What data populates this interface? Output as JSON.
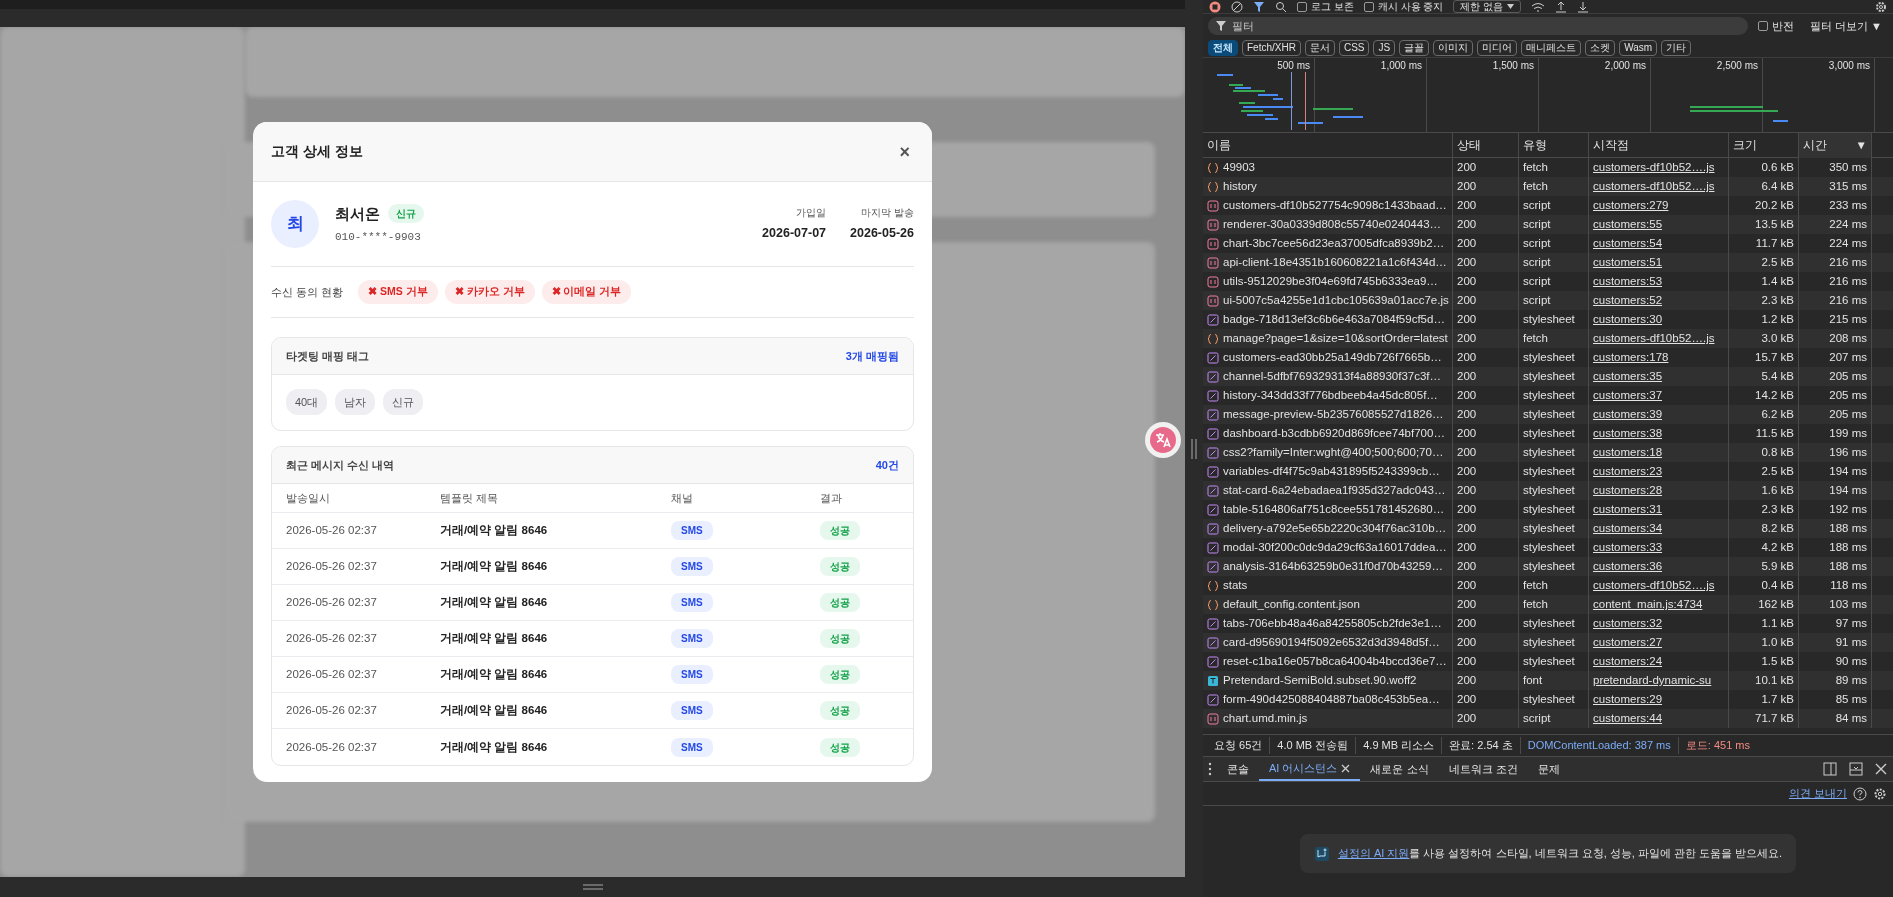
{
  "modal": {
    "title": "고객 상세 정보",
    "close": "×",
    "customer": {
      "initial": "최",
      "name": "최서온",
      "badge": "신규",
      "phone": "010-****-9903",
      "dates": [
        {
          "label": "가입일",
          "value": "2026-07-07"
        },
        {
          "label": "마지막 발송",
          "value": "2026-05-26"
        }
      ]
    },
    "consent": {
      "label": "수신 동의 현황",
      "items": [
        {
          "icon": "✖",
          "label": "SMS 거부",
          "agreed": false
        },
        {
          "icon": "✖",
          "label": "카카오 거부",
          "agreed": false
        },
        {
          "icon": "✖",
          "label": "이메일 거부",
          "agreed": false
        }
      ]
    },
    "tags": {
      "title": "타겟팅 매핑 태그",
      "count": "3개 매핑됨",
      "items": [
        "40대",
        "남자",
        "신규"
      ]
    },
    "messages": {
      "title": "최근 메시지 수신 내역",
      "count": "40건",
      "columns": [
        "발송일시",
        "템플릿 제목",
        "채널",
        "결과"
      ],
      "rows": [
        {
          "sent_at": "2026-05-26 02:37",
          "template": "거래/예약 알림 8646",
          "channel": "SMS",
          "result": "성공"
        },
        {
          "sent_at": "2026-05-26 02:37",
          "template": "거래/예약 알림 8646",
          "channel": "SMS",
          "result": "성공"
        },
        {
          "sent_at": "2026-05-26 02:37",
          "template": "거래/예약 알림 8646",
          "channel": "SMS",
          "result": "성공"
        },
        {
          "sent_at": "2026-05-26 02:37",
          "template": "거래/예약 알림 8646",
          "channel": "SMS",
          "result": "성공"
        },
        {
          "sent_at": "2026-05-26 02:37",
          "template": "거래/예약 알림 8646",
          "channel": "SMS",
          "result": "성공"
        },
        {
          "sent_at": "2026-05-26 02:37",
          "template": "거래/예약 알림 8646",
          "channel": "SMS",
          "result": "성공"
        },
        {
          "sent_at": "2026-05-26 02:37",
          "template": "거래/예약 알림 8646",
          "channel": "SMS",
          "result": "성공"
        }
      ]
    }
  },
  "devtools": {
    "toolbar": {
      "preserve_log": {
        "label": "로그 보존",
        "checked": false
      },
      "disable_cache": {
        "label": "캐시 사용 중지",
        "checked": false
      },
      "throttling": "제한 없음"
    },
    "filter": {
      "placeholder": "필터",
      "invert": {
        "label": "반전",
        "checked": false
      },
      "more": "필터 더보기 ▼"
    },
    "type_filters": [
      {
        "label": "전체",
        "selected": true
      },
      {
        "label": "Fetch/XHR",
        "selected": false
      },
      {
        "label": "문서",
        "selected": false
      },
      {
        "label": "CSS",
        "selected": false
      },
      {
        "label": "JS",
        "selected": false
      },
      {
        "label": "글꼴",
        "selected": false
      },
      {
        "label": "이미지",
        "selected": false
      },
      {
        "label": "미디어",
        "selected": false
      },
      {
        "label": "매니페스트",
        "selected": false
      },
      {
        "label": "소켓",
        "selected": false
      },
      {
        "label": "Wasm",
        "selected": false
      },
      {
        "label": "기타",
        "selected": false
      }
    ],
    "overview_ticks": [
      "500 ms",
      "1,000 ms",
      "1,500 ms",
      "2,000 ms",
      "2,500 ms",
      "3,000 ms"
    ],
    "columns": [
      {
        "label": "이름",
        "sorted": false
      },
      {
        "label": "상태",
        "sorted": false
      },
      {
        "label": "유형",
        "sorted": false
      },
      {
        "label": "시작점",
        "sorted": false
      },
      {
        "label": "크기",
        "sorted": false
      },
      {
        "label": "시간",
        "sorted": true,
        "sort_icon": "▼"
      }
    ],
    "requests": [
      {
        "kind": "fetch",
        "name": "49903",
        "status": "200",
        "type": "fetch",
        "initiator": "customers-df10b52….js",
        "size": "0.6 kB",
        "time": "350 ms"
      },
      {
        "kind": "fetch",
        "name": "history",
        "status": "200",
        "type": "fetch",
        "initiator": "customers-df10b52….js",
        "size": "6.4 kB",
        "time": "315 ms"
      },
      {
        "kind": "script",
        "name": "customers-df10b527754c9098c1433baad…",
        "status": "200",
        "type": "script",
        "initiator": "customers:279",
        "size": "20.2 kB",
        "time": "233 ms"
      },
      {
        "kind": "script",
        "name": "renderer-30a0339d808c55740e0240443…",
        "status": "200",
        "type": "script",
        "initiator": "customers:55",
        "size": "13.5 kB",
        "time": "224 ms"
      },
      {
        "kind": "script",
        "name": "chart-3bc7cee56d23ea37005dfca8939b2…",
        "status": "200",
        "type": "script",
        "initiator": "customers:54",
        "size": "11.7 kB",
        "time": "224 ms"
      },
      {
        "kind": "script",
        "name": "api-client-18e4351b160608221a1c6f434d…",
        "status": "200",
        "type": "script",
        "initiator": "customers:51",
        "size": "2.5 kB",
        "time": "216 ms"
      },
      {
        "kind": "script",
        "name": "utils-9512029be3f04e69fd745b6333ea9…",
        "status": "200",
        "type": "script",
        "initiator": "customers:53",
        "size": "1.4 kB",
        "time": "216 ms"
      },
      {
        "kind": "script",
        "name": "ui-5007c5a4255e1d1cbc105639a01acc7e.js",
        "status": "200",
        "type": "script",
        "initiator": "customers:52",
        "size": "2.3 kB",
        "time": "216 ms"
      },
      {
        "kind": "stylesheet",
        "name": "badge-718d13ef3c6b6e463a7084f59cf5d…",
        "status": "200",
        "type": "stylesheet",
        "initiator": "customers:30",
        "size": "1.2 kB",
        "time": "215 ms"
      },
      {
        "kind": "fetch",
        "name": "manage?page=1&size=10&sortOrder=latest",
        "status": "200",
        "type": "fetch",
        "initiator": "customers-df10b52….js",
        "size": "3.0 kB",
        "time": "208 ms"
      },
      {
        "kind": "stylesheet",
        "name": "customers-ead30bb25a149db726f7665b…",
        "status": "200",
        "type": "stylesheet",
        "initiator": "customers:178",
        "size": "15.7 kB",
        "time": "207 ms"
      },
      {
        "kind": "stylesheet",
        "name": "channel-5dfbf769329313f4a88930f37c3f…",
        "status": "200",
        "type": "stylesheet",
        "initiator": "customers:35",
        "size": "5.4 kB",
        "time": "205 ms"
      },
      {
        "kind": "stylesheet",
        "name": "history-343dd33f776bdbeeb4a45dc805f…",
        "status": "200",
        "type": "stylesheet",
        "initiator": "customers:37",
        "size": "14.2 kB",
        "time": "205 ms"
      },
      {
        "kind": "stylesheet",
        "name": "message-preview-5b23576085527d1826…",
        "status": "200",
        "type": "stylesheet",
        "initiator": "customers:39",
        "size": "6.2 kB",
        "time": "205 ms"
      },
      {
        "kind": "stylesheet",
        "name": "dashboard-b3cdbb6920d869fcee74bf700…",
        "status": "200",
        "type": "stylesheet",
        "initiator": "customers:38",
        "size": "11.5 kB",
        "time": "199 ms"
      },
      {
        "kind": "stylesheet",
        "name": "css2?family=Inter:wght@400;500;600;70…",
        "status": "200",
        "type": "stylesheet",
        "initiator": "customers:18",
        "size": "0.8 kB",
        "time": "196 ms"
      },
      {
        "kind": "stylesheet",
        "name": "variables-df4f75c9ab431895f5243399cb…",
        "status": "200",
        "type": "stylesheet",
        "initiator": "customers:23",
        "size": "2.5 kB",
        "time": "194 ms"
      },
      {
        "kind": "stylesheet",
        "name": "stat-card-6a24ebadaea1f935d327adc043…",
        "status": "200",
        "type": "stylesheet",
        "initiator": "customers:28",
        "size": "1.6 kB",
        "time": "194 ms"
      },
      {
        "kind": "stylesheet",
        "name": "table-5164806af751c8cee551781452680…",
        "status": "200",
        "type": "stylesheet",
        "initiator": "customers:31",
        "size": "2.3 kB",
        "time": "192 ms"
      },
      {
        "kind": "stylesheet",
        "name": "delivery-a792e5e65b2220c304f76ac310b…",
        "status": "200",
        "type": "stylesheet",
        "initiator": "customers:34",
        "size": "8.2 kB",
        "time": "188 ms"
      },
      {
        "kind": "stylesheet",
        "name": "modal-30f200c0dc9da29cf63a16017ddea…",
        "status": "200",
        "type": "stylesheet",
        "initiator": "customers:33",
        "size": "4.2 kB",
        "time": "188 ms"
      },
      {
        "kind": "stylesheet",
        "name": "analysis-3164b63259b0e31f0d70b43259…",
        "status": "200",
        "type": "stylesheet",
        "initiator": "customers:36",
        "size": "5.9 kB",
        "time": "188 ms"
      },
      {
        "kind": "fetch",
        "name": "stats",
        "status": "200",
        "type": "fetch",
        "initiator": "customers-df10b52….js",
        "size": "0.4 kB",
        "time": "118 ms"
      },
      {
        "kind": "fetch",
        "name": "default_config.content.json",
        "status": "200",
        "type": "fetch",
        "initiator": "content_main.js:4734",
        "size": "162 kB",
        "time": "103 ms"
      },
      {
        "kind": "stylesheet",
        "name": "tabs-706ebb48a46a84255805cb2fde3e1…",
        "status": "200",
        "type": "stylesheet",
        "initiator": "customers:32",
        "size": "1.1 kB",
        "time": "97 ms"
      },
      {
        "kind": "stylesheet",
        "name": "card-d95690194f5092e6532d3d3948d5f…",
        "status": "200",
        "type": "stylesheet",
        "initiator": "customers:27",
        "size": "1.0 kB",
        "time": "91 ms"
      },
      {
        "kind": "stylesheet",
        "name": "reset-c1ba16e057b8ca64004b4bccd36e7…",
        "status": "200",
        "type": "stylesheet",
        "initiator": "customers:24",
        "size": "1.5 kB",
        "time": "90 ms"
      },
      {
        "kind": "font",
        "name": "Pretendard-SemiBold.subset.90.woff2",
        "status": "200",
        "type": "font",
        "initiator": "pretendard-dynamic-su",
        "size": "10.1 kB",
        "time": "89 ms"
      },
      {
        "kind": "stylesheet",
        "name": "form-490d425088404887ba08c453b5ea…",
        "status": "200",
        "type": "stylesheet",
        "initiator": "customers:29",
        "size": "1.7 kB",
        "time": "85 ms"
      },
      {
        "kind": "script",
        "name": "chart.umd.min.js",
        "status": "200",
        "type": "script",
        "initiator": "customers:44",
        "size": "71.7 kB",
        "time": "84 ms"
      }
    ],
    "summary": [
      {
        "kind": "plain",
        "text": "요청 65건"
      },
      {
        "kind": "plain",
        "text": "4.0 MB 전송됨"
      },
      {
        "kind": "plain",
        "text": "4.9 MB 리소스"
      },
      {
        "kind": "plain",
        "text": "완료: 2.54 초"
      },
      {
        "kind": "domcontent",
        "text": "DOMContentLoaded: 387 ms"
      },
      {
        "kind": "load",
        "text": "로드: 451 ms"
      }
    ],
    "drawer_tabs": [
      {
        "label": "콘솔",
        "selected": false,
        "closable": false
      },
      {
        "label": "AI 어시스턴스",
        "selected": true,
        "closable": true
      },
      {
        "label": "새로운 소식",
        "selected": false,
        "closable": false
      },
      {
        "label": "네트워크 조건",
        "selected": false,
        "closable": false
      },
      {
        "label": "문제",
        "selected": false,
        "closable": false
      }
    ],
    "feedback_link": "의견 보내기",
    "ai_notice": {
      "link": "설정의 AI 지원",
      "text": "를 사용 설정하여 스타일, 네트워크 요청, 성능, 파일에 관한 도움을 받으세요."
    }
  }
}
